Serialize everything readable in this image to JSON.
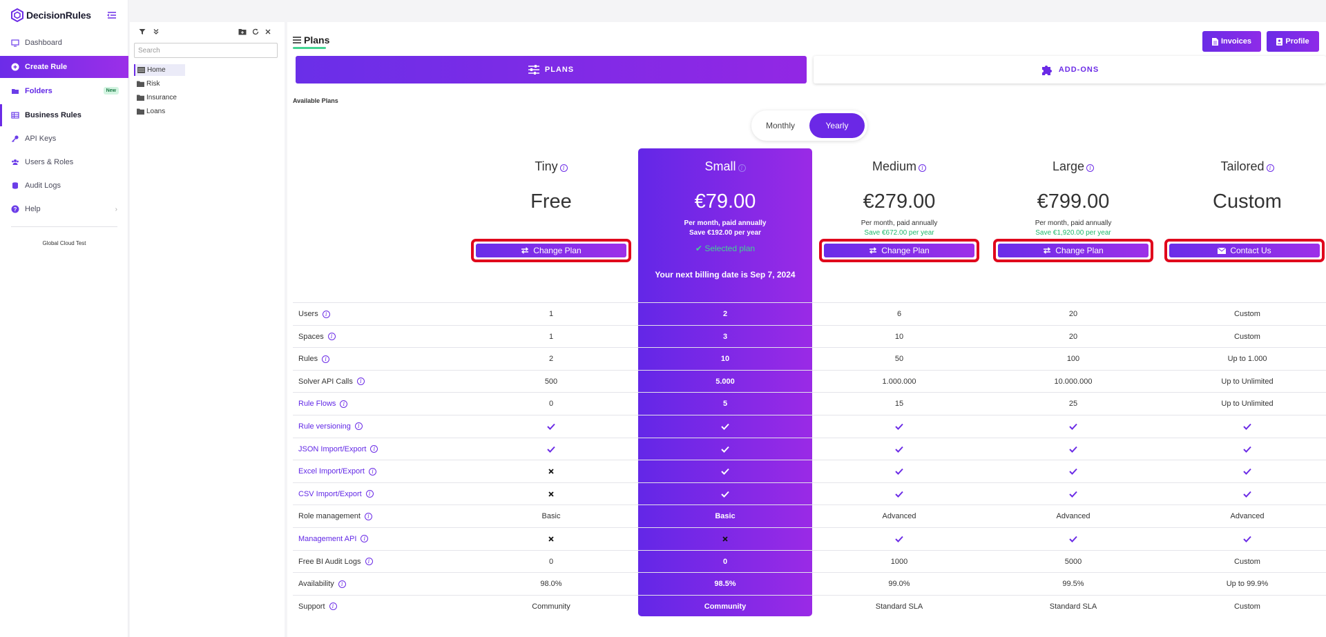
{
  "app": {
    "name": "DecisionRules"
  },
  "sidebar": {
    "items": [
      {
        "label": "Dashboard",
        "icon": "monitor-icon"
      },
      {
        "label": "Create Rule",
        "icon": "plus-circle-icon"
      },
      {
        "label": "Folders",
        "icon": "folder-open-icon",
        "badge": "New"
      },
      {
        "label": "Business Rules",
        "icon": "table-icon"
      },
      {
        "label": "API Keys",
        "icon": "key-icon"
      },
      {
        "label": "Users & Roles",
        "icon": "users-icon"
      },
      {
        "label": "Audit Logs",
        "icon": "database-icon"
      },
      {
        "label": "Help",
        "icon": "question-circle-icon"
      }
    ],
    "environment": "Global Cloud Test"
  },
  "tree": {
    "search_placeholder": "Search",
    "items": [
      "Home",
      "Risk",
      "Insurance",
      "Loans"
    ]
  },
  "header": {
    "title": "Plans",
    "invoices_label": "Invoices",
    "profile_label": "Profile"
  },
  "tabs": {
    "plans": "PLANS",
    "addons": "ADD-ONS"
  },
  "available_plans_label": "Available Plans",
  "billing_toggle": {
    "monthly": "Monthly",
    "yearly": "Yearly",
    "selected": "Yearly"
  },
  "plans": [
    {
      "name": "Tiny",
      "price": "Free",
      "period": "",
      "save": "",
      "action": "Change Plan"
    },
    {
      "name": "Small",
      "price": "€79.00",
      "period": "Per month, paid annually",
      "save": "Save €192.00 per year",
      "action": "Selected plan"
    },
    {
      "name": "Medium",
      "price": "€279.00",
      "period": "Per month, paid annually",
      "save": "Save €672.00 per year",
      "action": "Change Plan"
    },
    {
      "name": "Large",
      "price": "€799.00",
      "period": "Per month, paid annually",
      "save": "Save €1,920.00 per year",
      "action": "Change Plan"
    },
    {
      "name": "Tailored",
      "price": "Custom",
      "period": "",
      "save": "",
      "action": "Contact Us"
    }
  ],
  "billing_note": "Your next billing date is Sep 7, 2024",
  "features": [
    {
      "label": "Users",
      "link": false,
      "values": [
        "1",
        "2",
        "6",
        "20",
        "Custom"
      ]
    },
    {
      "label": "Spaces",
      "link": false,
      "values": [
        "1",
        "3",
        "10",
        "20",
        "Custom"
      ]
    },
    {
      "label": "Rules",
      "link": false,
      "values": [
        "2",
        "10",
        "50",
        "100",
        "Up to 1.000"
      ]
    },
    {
      "label": "Solver API Calls",
      "link": false,
      "values": [
        "500",
        "5.000",
        "1.000.000",
        "10.000.000",
        "Up to Unlimited"
      ]
    },
    {
      "label": "Rule Flows",
      "link": true,
      "values": [
        "0",
        "5",
        "15",
        "25",
        "Up to Unlimited"
      ]
    },
    {
      "label": "Rule versioning",
      "link": true,
      "values": [
        "check",
        "check",
        "check",
        "check",
        "check"
      ]
    },
    {
      "label": "JSON Import/Export",
      "link": true,
      "values": [
        "check",
        "check",
        "check",
        "check",
        "check"
      ]
    },
    {
      "label": "Excel Import/Export",
      "link": true,
      "values": [
        "cross",
        "check",
        "check",
        "check",
        "check"
      ]
    },
    {
      "label": "CSV Import/Export",
      "link": true,
      "values": [
        "cross",
        "check",
        "check",
        "check",
        "check"
      ]
    },
    {
      "label": "Role management",
      "link": false,
      "values": [
        "Basic",
        "Basic",
        "Advanced",
        "Advanced",
        "Advanced"
      ]
    },
    {
      "label": "Management API",
      "link": true,
      "values": [
        "cross",
        "cross",
        "check",
        "check",
        "check"
      ]
    },
    {
      "label": "Free BI Audit Logs",
      "link": false,
      "values": [
        "0",
        "0",
        "1000",
        "5000",
        "Custom"
      ]
    },
    {
      "label": "Availability",
      "link": false,
      "values": [
        "98.0%",
        "98.5%",
        "99.0%",
        "99.5%",
        "Up to 99.9%"
      ]
    },
    {
      "label": "Support",
      "link": false,
      "values": [
        "Community",
        "Community",
        "Standard SLA",
        "Standard SLA",
        "Custom"
      ]
    }
  ],
  "colors": {
    "accent": "#6b2be6",
    "accent_end": "#9a2ae6",
    "success": "#1eb86a",
    "highlight_border": "#e0061c"
  }
}
